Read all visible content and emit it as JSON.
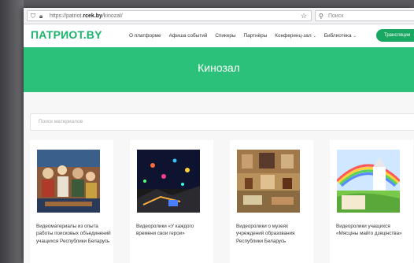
{
  "browser": {
    "url_prefix": "https://patriot.",
    "url_domain": "rcek.by",
    "url_path": "/kinozal/",
    "search_placeholder": "Поиск"
  },
  "site": {
    "logo": "ПАТРИОТ.BY",
    "nav": [
      {
        "label": "О платформе"
      },
      {
        "label": "Афиша событий"
      },
      {
        "label": "Спикеры"
      },
      {
        "label": "Партнёры"
      },
      {
        "label": "Конференц-зал",
        "caret": "⌄"
      },
      {
        "label": "Библиотека",
        "caret": "⌄"
      }
    ],
    "stream_button": "Трансляции"
  },
  "banner": {
    "title": "Кинозал"
  },
  "search": {
    "placeholder": "Поиск материалов"
  },
  "cards": [
    {
      "title": "Видеоматериалы из опыта работы поисковых объединений учащихся Республики Беларусь"
    },
    {
      "title": "Видеоролики «У каждого времени свои герои»"
    },
    {
      "title": "Видеоролики о музеях учреждений образования Республики Беларусь"
    },
    {
      "title": "Видеоролики учащихся «Мясціны майго дзяцінства»"
    }
  ],
  "colors": {
    "brand": "#1ab36b",
    "banner": "#2bc17a",
    "button": "#18a862"
  },
  "icons": [
    "shield-icon",
    "lock-icon",
    "star-icon",
    "search-icon"
  ]
}
